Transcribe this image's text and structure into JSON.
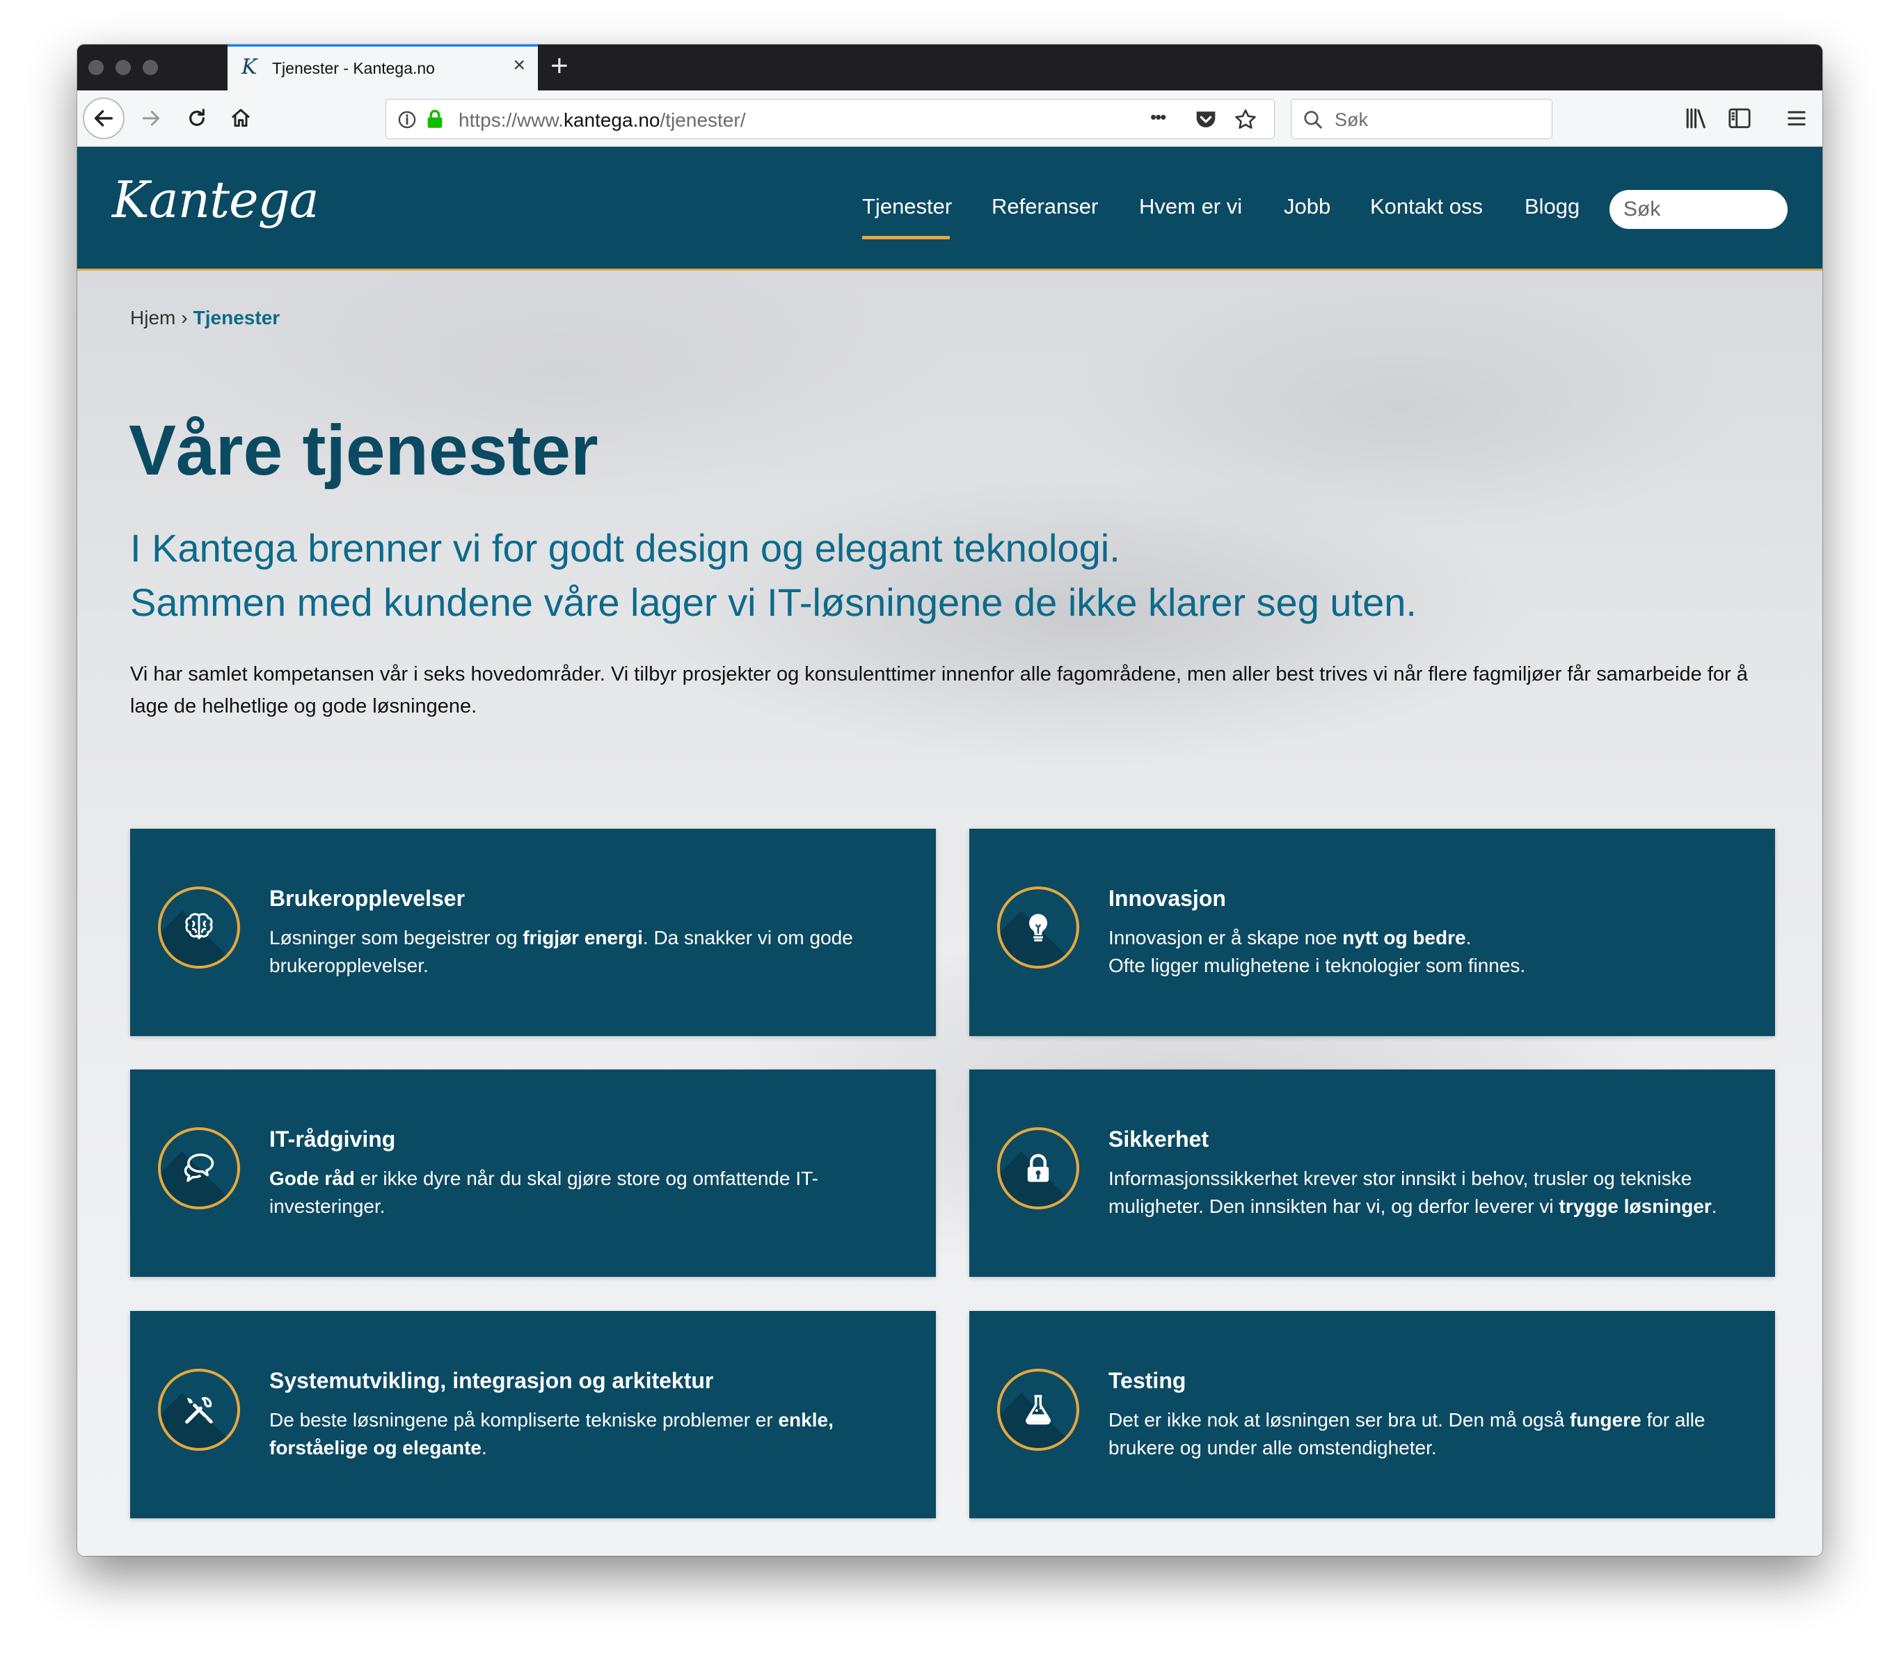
{
  "browser": {
    "tab_title": "Tjenester - Kantega.no",
    "tab_favicon": "K",
    "new_tab_label": "+",
    "close_tab_label": "×",
    "url_prefix": "https://www.",
    "url_domain": "kantega.no",
    "url_path": "/tjenester/",
    "search_placeholder": "Søk",
    "page_actions_label": "•••",
    "accent_color": "#0a84ff"
  },
  "site": {
    "logo": "Kantega",
    "nav": [
      "Tjenester",
      "Referanser",
      "Hvem er vi",
      "Jobb",
      "Kontakt oss",
      "Blogg"
    ],
    "active_nav": "Tjenester",
    "search_placeholder": "Søk",
    "brand_color": "#0b4a63",
    "accent_color": "#e3a83f"
  },
  "breadcrumb": {
    "home": "Hjem",
    "separator": "›",
    "current": "Tjenester"
  },
  "hero": {
    "title": "Våre tjenester",
    "lead_line1": "I Kantega brenner vi for godt design og elegant teknologi.",
    "lead_line2": "Sammen med kundene våre lager vi IT-løsningene de ikke klarer seg uten.",
    "body": "Vi har samlet kompetansen vår i seks hovedområder. Vi tilbyr prosjekter og konsulenttimer innenfor alle fagområdene, men aller best trives vi når flere fagmiljøer får samarbeide for å lage de helhetlige og gode løsningene."
  },
  "services": [
    {
      "icon": "brain-icon",
      "title": "Brukeropplevelser",
      "desc": [
        {
          "t": "Løsninger som begeistrer og "
        },
        {
          "t": "frigjør energi",
          "b": true
        },
        {
          "t": ". Da snakker vi om gode brukeropplevelser."
        }
      ]
    },
    {
      "icon": "lightbulb-icon",
      "title": "Innovasjon",
      "desc": [
        {
          "t": "Innovasjon er å skape noe "
        },
        {
          "t": "nytt og bedre",
          "b": true
        },
        {
          "t": "."
        },
        {
          "br": true
        },
        {
          "t": "Ofte ligger mulighetene i teknologier som finnes."
        }
      ]
    },
    {
      "icon": "speech-bubbles-icon",
      "title": "IT-rådgiving",
      "desc": [
        {
          "t": "Gode råd",
          "b": true
        },
        {
          "t": " er ikke dyre når du skal gjøre store og omfattende IT-investeringer."
        }
      ]
    },
    {
      "icon": "padlock-icon",
      "title": "Sikkerhet",
      "desc": [
        {
          "t": "Informasjonssikkerhet krever stor innsikt i behov, trusler og tekniske muligheter. Den innsikten har vi, og derfor leverer vi "
        },
        {
          "t": "trygge løsninger",
          "b": true
        },
        {
          "t": "."
        }
      ]
    },
    {
      "icon": "tools-icon",
      "title": "Systemutvikling, integrasjon og arkitektur",
      "desc": [
        {
          "t": "De beste løsningene på kompliserte tekniske problemer er "
        },
        {
          "t": "enkle, forståelige og elegante",
          "b": true
        },
        {
          "t": "."
        }
      ]
    },
    {
      "icon": "flask-icon",
      "title": "Testing",
      "desc": [
        {
          "t": "Det er ikke nok at løsningen ser bra ut. Den må også "
        },
        {
          "t": "fungere",
          "b": true
        },
        {
          "t": " for alle brukere og under alle omstendigheter."
        }
      ]
    }
  ]
}
